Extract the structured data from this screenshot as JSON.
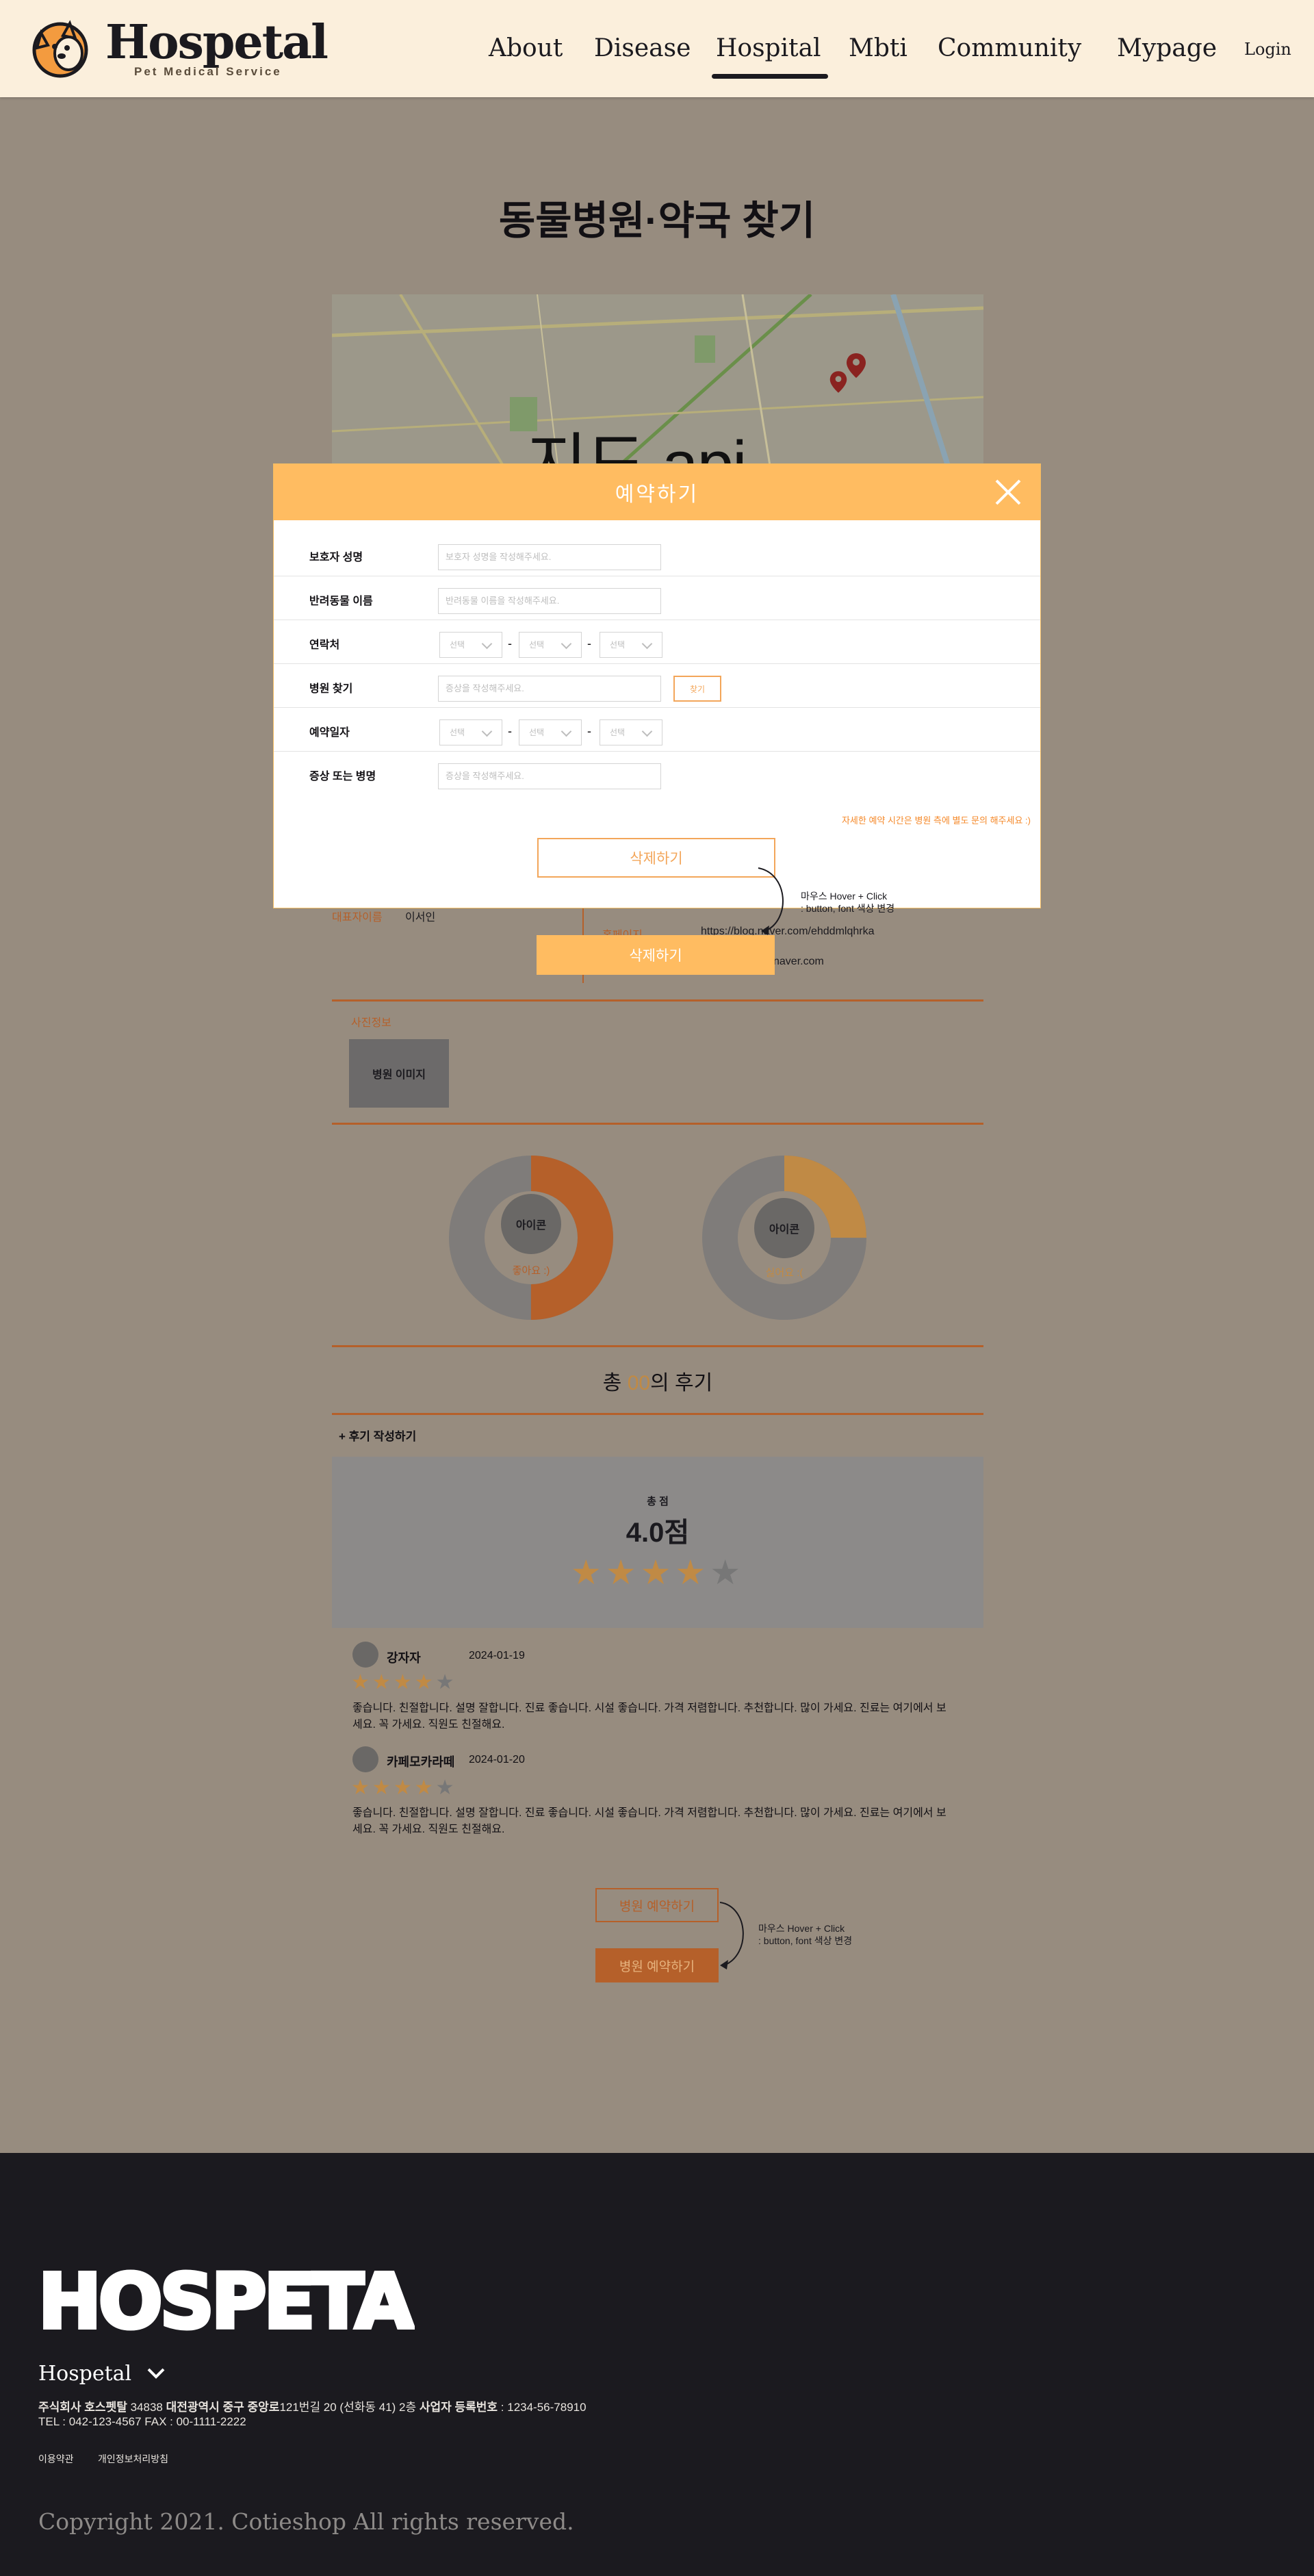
{
  "header": {
    "logo_text": "Hospetal",
    "logo_sub": "Pet Medical Service",
    "nav": [
      {
        "label": "About"
      },
      {
        "label": "Disease"
      },
      {
        "label": "Hospital"
      },
      {
        "label": "Mbti"
      },
      {
        "label": "Community"
      },
      {
        "label": "Mypage"
      }
    ],
    "login": "Login"
  },
  "page": {
    "title": "동물병원·약국 찾기",
    "map_placeholder": "지도 api"
  },
  "info": {
    "rep_label": "대표자이름",
    "rep_value": "이서인",
    "homepage_label": "홈페이지",
    "homepage_value": "https://blog.naver.com/ehddmlqhrka",
    "email_value": "naver.com",
    "photo_label": "사진정보",
    "photo_placeholder": "병원 이미지"
  },
  "stats": {
    "like": {
      "icon_label": "아이콘",
      "label": "좋아요 :)",
      "value": 0.5
    },
    "dislike": {
      "icon_label": "아이콘",
      "label": "싫어요 :(",
      "value": 0.25
    }
  },
  "reviews": {
    "total_prefix": "총 ",
    "total_count": "00",
    "total_suffix": "의 후기",
    "write": "+ 후기 작성하기",
    "score_label": "총 점",
    "score": "4.0점",
    "score_stars": 4,
    "items": [
      {
        "name": "강자자",
        "date": "2024-01-19",
        "stars": 4,
        "text": "좋습니다. 친절합니다. 설명 잘합니다. 진료 좋습니다. 시설 좋습니다. 가격 저렴합니다. 추천합니다. 많이 가세요. 진료는 여기에서 보세요. 꼭 가세요. 직원도 친절해요."
      },
      {
        "name": "카페모카라떼",
        "date": "2024-01-20",
        "stars": 4,
        "text": "좋습니다. 친절합니다. 설명 잘합니다. 진료 좋습니다. 시설 좋습니다. 가격 저렴합니다. 추천합니다. 많이 가세요. 진료는 여기에서 보세요. 꼭 가세요. 직원도 친절해요."
      }
    ],
    "reserve_btn": "병원 예약하기",
    "reserve_btn_hover": "병원 예약하기",
    "hint_line1": "마우스 Hover + Click",
    "hint_line2": ": button, font 색상 변경"
  },
  "modal": {
    "title": "예약하기",
    "rows": [
      {
        "label": "보호자 성명",
        "placeholder": "보호자 성명을 작성해주세요."
      },
      {
        "label": "반려동물 이름",
        "placeholder": "반려동물 이름을 작성해주세요."
      },
      {
        "label": "연락처"
      },
      {
        "label": "병원 찾기",
        "placeholder": "증상을 작성해주세요."
      },
      {
        "label": "예약일자"
      },
      {
        "label": "증상 또는 병명",
        "placeholder": "증상을 작성해주세요."
      }
    ],
    "select_text": "선택",
    "dash": "-",
    "find_btn": "찾기",
    "note": "자세한 예약 시간은 병원 측에 별도 문의 해주세요 :)",
    "delete_btn": "삭제하기",
    "delete_btn_hover": "삭제하기",
    "hint_line1": "마우스 Hover + Click",
    "hint_line2": ": button, font 색상 변경"
  },
  "footer": {
    "logo_text": "HOSPETAL",
    "brand": "Hospetal",
    "address_company": "주식회사 호스펫탈 ",
    "address_zip": "34838 ",
    "address_main": "대전광역시 중구 중앙로",
    "address_detail": "121번길 20 (선화동 41) 2층  ",
    "biz_label": "사업자 등록번호 ",
    "biz_value": ": 1234-56-78910",
    "tel": "TEL : 042-123-4567 FAX : 00-1111-2222",
    "terms": "이용약관",
    "privacy": "개인정보처리방침",
    "copyright": "Copyright 2021. Cotieshop All rights reserved."
  },
  "colors": {
    "accent": "#ffbc61",
    "brand_orange": "#b5602a",
    "overlay": "#978c7f",
    "footer_bg": "#1b1a1f",
    "header_bg": "#fbefdc"
  }
}
